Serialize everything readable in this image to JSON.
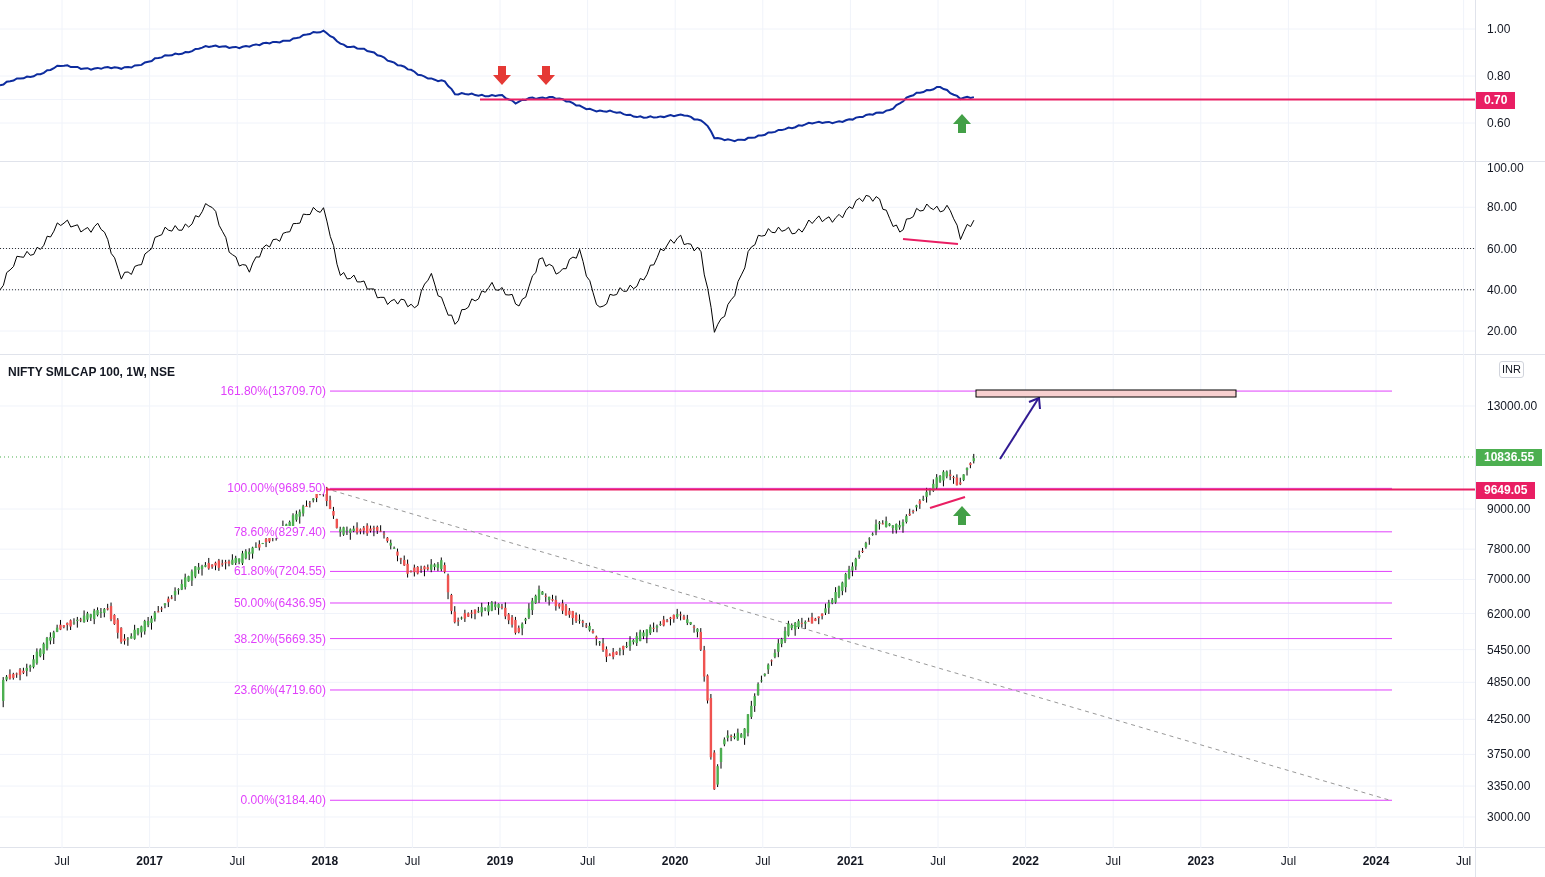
{
  "ratio_pane": {
    "ticks": [
      "1.00",
      "0.80",
      "0.60"
    ],
    "level_tag": {
      "text": "0.70",
      "color": "#e91e63"
    }
  },
  "oscillator_pane": {
    "ticks": [
      "100.00",
      "80.00",
      "60.00",
      "40.00",
      "20.00"
    ]
  },
  "price_pane": {
    "title": "NIFTY SMLCAP 100, 1W, NSE",
    "currency_badge": "INR",
    "ticks": [
      "13000.00",
      "9000.00",
      "7800.00",
      "7000.00",
      "6200.00",
      "5450.00",
      "4850.00",
      "4250.00",
      "3750.00",
      "3350.00",
      "3000.00"
    ],
    "last_price_tag": {
      "text": "10836.55",
      "color": "#4caf50"
    },
    "level_tag": {
      "text": "9649.05",
      "color": "#e91e63"
    },
    "fib_levels": [
      {
        "label": "161.80%(13709.70)"
      },
      {
        "label": "100.00%(9689.50)"
      },
      {
        "label": "78.60%(8297.40)"
      },
      {
        "label": "61.80%(7204.55)"
      },
      {
        "label": "50.00%(6436.95)"
      },
      {
        "label": "38.20%(5669.35)"
      },
      {
        "label": "23.60%(4719.60)"
      },
      {
        "label": "0.00%(3184.40)"
      }
    ]
  },
  "time_axis": [
    {
      "label": "Jul",
      "kind": "month"
    },
    {
      "label": "2017",
      "kind": "year"
    },
    {
      "label": "Jul",
      "kind": "month"
    },
    {
      "label": "2018",
      "kind": "year"
    },
    {
      "label": "Jul",
      "kind": "month"
    },
    {
      "label": "2019",
      "kind": "year"
    },
    {
      "label": "Jul",
      "kind": "month"
    },
    {
      "label": "2020",
      "kind": "year"
    },
    {
      "label": "Jul",
      "kind": "month"
    },
    {
      "label": "2021",
      "kind": "year"
    },
    {
      "label": "Jul",
      "kind": "month"
    },
    {
      "label": "2022",
      "kind": "year"
    },
    {
      "label": "Jul",
      "kind": "month"
    },
    {
      "label": "2023",
      "kind": "year"
    },
    {
      "label": "Jul",
      "kind": "month"
    },
    {
      "label": "2024",
      "kind": "year"
    },
    {
      "label": "Jul",
      "kind": "month"
    }
  ]
}
